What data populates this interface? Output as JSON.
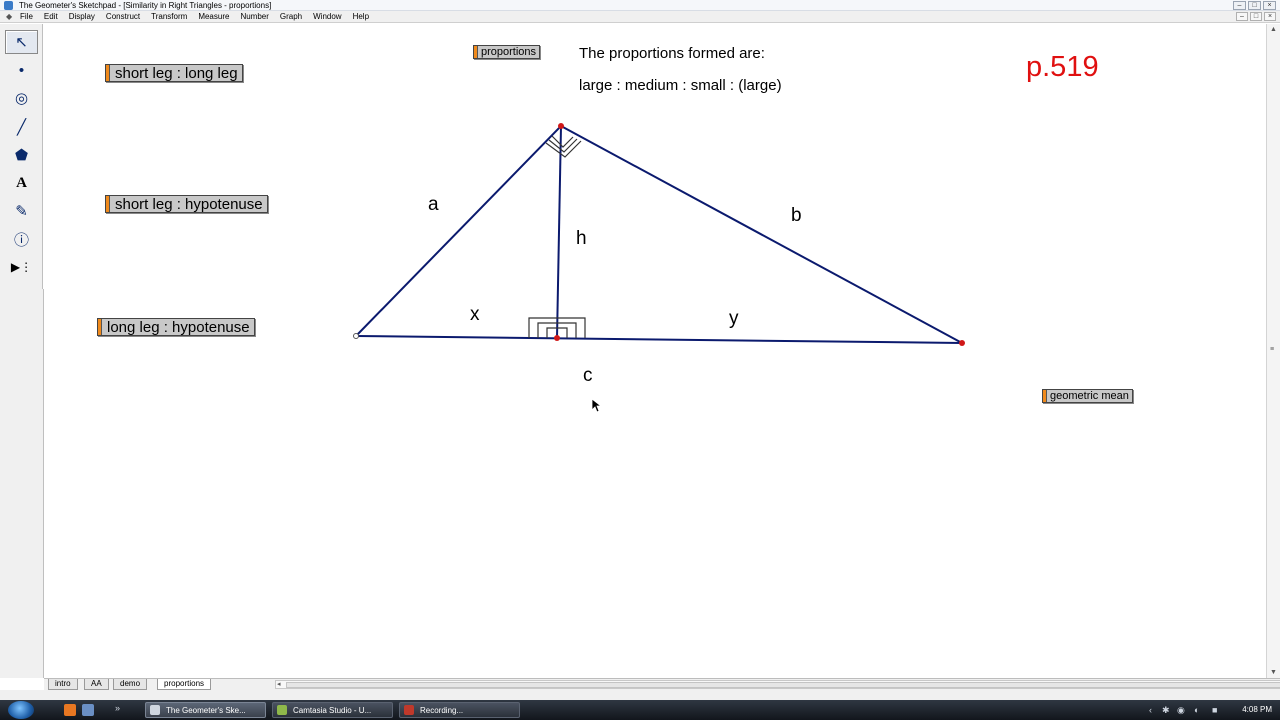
{
  "window": {
    "title": "The Geometer's Sketchpad - [Similarity in Right Triangles - proportions]",
    "controls": [
      "–",
      "□",
      "×"
    ]
  },
  "menu": [
    "File",
    "Edit",
    "Display",
    "Construct",
    "Transform",
    "Measure",
    "Number",
    "Graph",
    "Window",
    "Help"
  ],
  "mdi_controls": [
    "–",
    "□",
    "×"
  ],
  "toolbox": [
    {
      "icon": "arrow-select-icon",
      "glyph": "↖",
      "active": true
    },
    {
      "icon": "point-tool-icon",
      "glyph": "•"
    },
    {
      "icon": "compass-circle-icon",
      "glyph": "◎"
    },
    {
      "icon": "straightedge-icon",
      "glyph": "╱"
    },
    {
      "icon": "polygon-tool-icon",
      "glyph": "⬟"
    },
    {
      "icon": "text-tool-icon",
      "glyph": "A"
    },
    {
      "icon": "marker-tool-icon",
      "glyph": "✎"
    },
    {
      "icon": "information-tool-icon",
      "glyph": "ⓘ"
    },
    {
      "icon": "custom-tool-icon",
      "glyph": "▶⋮"
    }
  ],
  "buttons": {
    "short_long": "short leg : long leg",
    "short_hyp": "short leg : hypotenuse",
    "long_hyp": "long leg : hypotenuse",
    "proportions": "proportions",
    "geometric_mean": "geometric mean"
  },
  "text": {
    "heading": "The proportions formed are:",
    "ratio_line": "large : medium : small : (large)",
    "page_ref": "p.519"
  },
  "segment_labels": {
    "a": "a",
    "b": "b",
    "h": "h",
    "x": "x",
    "y": "y",
    "c": "c"
  },
  "colors": {
    "segment": "#0b1a6e",
    "vertex": "#d01818",
    "page_ref": "#e01010",
    "button_tag": "#f08a1c"
  },
  "page_tabs": [
    "intro",
    "AA",
    "demo",
    "proportions"
  ],
  "active_tab": "proportions",
  "taskbar": {
    "items": [
      "The Geometer's Ske...",
      "Camtasia Studio - U...",
      "Recording..."
    ],
    "clock": "4:08 PM"
  }
}
